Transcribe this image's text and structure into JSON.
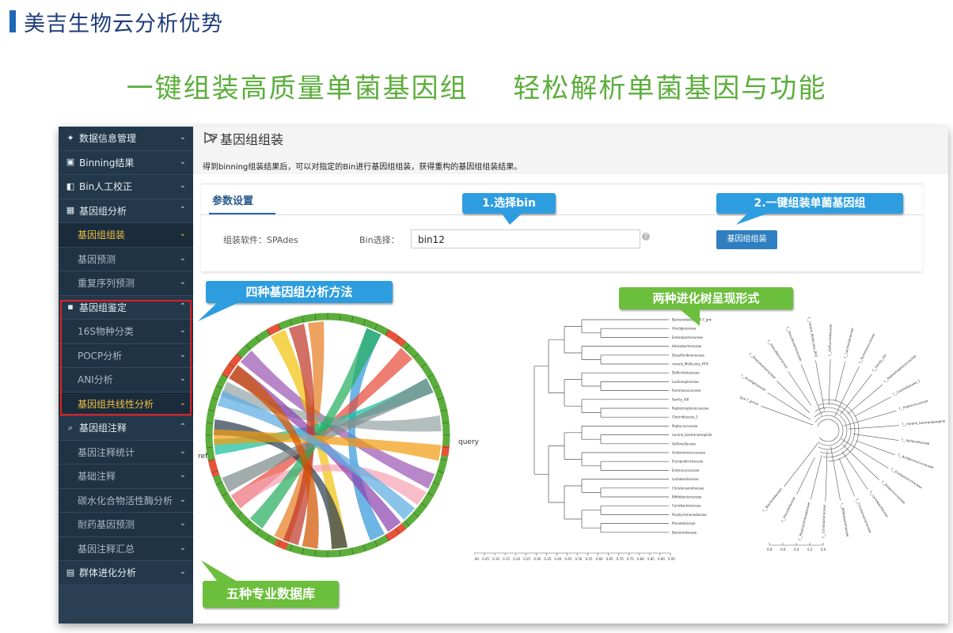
{
  "header": {
    "title": "美吉生物云分析优势"
  },
  "banner": {
    "left": "一键组装高质量单菌基因组",
    "right": "轻松解析单菌基因与功能"
  },
  "colors": {
    "sidebar_bg": "#2a3f54",
    "active_item": "#f0c040",
    "callout_blue": "#2d9de0",
    "callout_green": "#6cbf3c",
    "banner_green": "#5cae3c",
    "highlight_red": "#e02020"
  },
  "sidebar": {
    "items": [
      {
        "label": "数据信息管理",
        "icon": "share-icon",
        "chevron": "⌄"
      },
      {
        "label": "Binning结果",
        "icon": "save-icon",
        "chevron": "⌄"
      },
      {
        "label": "Bin人工校正",
        "icon": "panel-icon",
        "chevron": "⌄"
      },
      {
        "label": "基因组分析",
        "icon": "grid-icon",
        "chevron": "⌃"
      },
      {
        "label": "基因组组装",
        "chevron": "⌄"
      },
      {
        "label": "基因预测",
        "chevron": "⌄"
      },
      {
        "label": "重复序列预测",
        "chevron": "⌄"
      },
      {
        "label": "基因组鉴定",
        "icon": "tiles-icon",
        "chevron": "⌃"
      },
      {
        "label": "16S物种分类",
        "chevron": "⌄"
      },
      {
        "label": "POCP分析",
        "chevron": "⌄"
      },
      {
        "label": "ANI分析",
        "chevron": "⌄"
      },
      {
        "label": "基因组共线性分析",
        "chevron": "⌄"
      },
      {
        "label": "基因组注释",
        "icon": "search-icon",
        "chevron": "⌃"
      },
      {
        "label": "基因注释统计",
        "chevron": "⌄"
      },
      {
        "label": "基础注释",
        "chevron": "⌄"
      },
      {
        "label": "碳水化合物活性酶分析",
        "chevron": "⌄"
      },
      {
        "label": "耐药基因预测",
        "chevron": "⌄"
      },
      {
        "label": "基因注释汇总",
        "chevron": "⌄"
      },
      {
        "label": "群体进化分析",
        "icon": "tree-icon",
        "chevron": "⌄"
      }
    ]
  },
  "main": {
    "title": "基因组组装",
    "description": "得到binning组装结果后，可以对指定的Bin进行基因组组装，获得重构的基因组组装结果。",
    "tab": "参数设置",
    "software_label": "组装软件：SPAdes",
    "bin_label": "Bin选择：",
    "bin_value": "bin12",
    "assemble_button": "基因组组装"
  },
  "callouts": {
    "select_bin": "1.选择bin",
    "one_click": "2.一键组装单菌基因组",
    "four_methods": "四种基因组分析方法",
    "two_trees": "两种进化树呈现形式",
    "five_db": "五种专业数据库"
  },
  "figures": {
    "circos": {
      "left_label": "ref",
      "right_label": "query"
    },
    "dendrogram": {
      "leaves": [
        "Bacteroidales_S24-7_group",
        "Alcaligenaceae",
        "Enterobacteriaceae",
        "Helicobacteraceae",
        "Desulfovibrionaceae",
        "norank_Mollicutes_RF9",
        "Defluviitaleaceae",
        "Lachnospiraceae",
        "Ruminococcaceae",
        "Family_XIII",
        "Peptostreptococcaceae",
        "Clostridiaceae_1",
        "Peptococcaceae",
        "norank_Gastranaerophilales",
        "Veillonellaceae",
        "Acidaminococcaceae",
        "Erysipelotrichaceae",
        "Enterococcaceae",
        "Lactobacillaceae",
        "Christensenellaceae",
        "Bifidobacteriaceae",
        "Coriobacteriaceae",
        "Porphyromonadaceae",
        "Prevotellaceae",
        "Bacteroidaceae"
      ],
      "axis_ticks": [
        "0.00",
        "0.05",
        "0.10",
        "0.15",
        "0.20",
        "0.25",
        "0.30",
        "0.35",
        "0.40",
        "0.45",
        "0.50",
        "0.55",
        "0.60",
        "0.65",
        "0.70",
        "0.75",
        "0.80",
        "0.85",
        "0.90",
        "0.95"
      ]
    },
    "radial_tree": {
      "scale_ticks": [
        "0.8",
        "0.6",
        "0.4",
        "0.2",
        "0.0"
      ]
    }
  }
}
